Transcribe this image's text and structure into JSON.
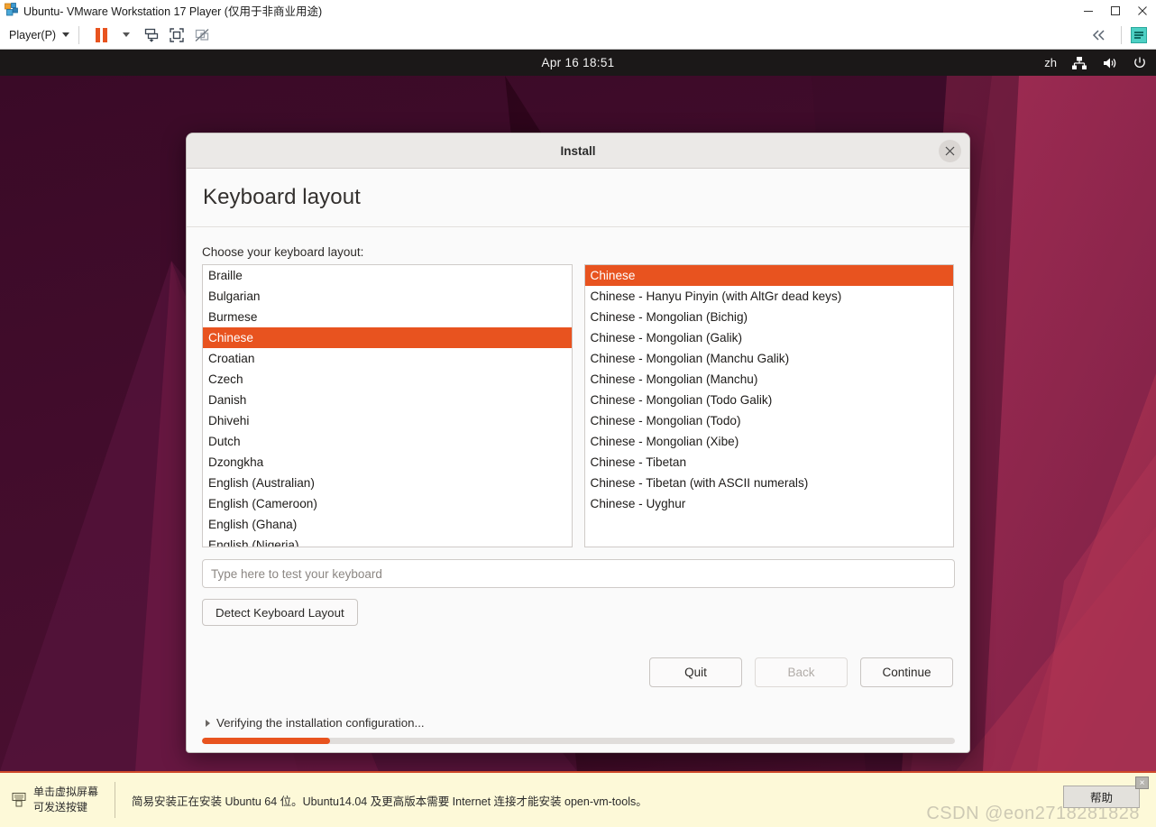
{
  "vmware": {
    "window_title": "Ubuntu- VMware Workstation 17 Player (仅用于非商业用途)",
    "app_icon": "vmware-logo-icon",
    "window_buttons": {
      "minimize": "minimize-icon",
      "maximize": "maximize-icon",
      "close": "close-icon"
    },
    "toolbar": {
      "player_menu": "Player(P)",
      "pause_button": "pause-icon",
      "pause_dropdown": "chevron-down-icon",
      "send_ctrl_alt_del": "send-key-icon",
      "fullscreen": "fullscreen-icon",
      "unity_mode": "unity-mode-icon",
      "collapse": "collapse-icon",
      "notes": "notes-icon"
    },
    "status_bar": {
      "hint_line1": "单击虚拟屏幕",
      "hint_line2": "可发送按键",
      "keyboard_icon": "keyboard-icon",
      "message": "简易安装正在安装 Ubuntu 64 位。Ubuntu14.04 及更高版本需要 Internet 连接才能安装 open-vm-tools。",
      "help_button": "帮助",
      "close_button": "×",
      "watermark": "CSDN @eon2718281828"
    }
  },
  "guest": {
    "panel": {
      "clock": "Apr 16  18:51",
      "keyboard_indicator": "zh",
      "network_icon": "network-wired-icon",
      "volume_icon": "volume-icon",
      "power_icon": "power-icon"
    },
    "wallpaper_colors": {
      "base": "#3b0a28",
      "dark": "#2d0520",
      "mid": "#772249",
      "light": "#9e2b52",
      "accent": "#b03050"
    }
  },
  "dialog": {
    "title": "Install",
    "close_label": "×",
    "page_title": "Keyboard layout",
    "choose_label": "Choose your keyboard layout:",
    "language_list": [
      {
        "label": "Braille",
        "selected": false
      },
      {
        "label": "Bulgarian",
        "selected": false
      },
      {
        "label": "Burmese",
        "selected": false
      },
      {
        "label": "Chinese",
        "selected": true
      },
      {
        "label": "Croatian",
        "selected": false
      },
      {
        "label": "Czech",
        "selected": false
      },
      {
        "label": "Danish",
        "selected": false
      },
      {
        "label": "Dhivehi",
        "selected": false
      },
      {
        "label": "Dutch",
        "selected": false
      },
      {
        "label": "Dzongkha",
        "selected": false
      },
      {
        "label": "English (Australian)",
        "selected": false
      },
      {
        "label": "English (Cameroon)",
        "selected": false
      },
      {
        "label": "English (Ghana)",
        "selected": false
      },
      {
        "label": "English (Nigeria)",
        "selected": false
      }
    ],
    "variant_list": [
      {
        "label": "Chinese",
        "selected": true
      },
      {
        "label": "Chinese - Hanyu Pinyin (with AltGr dead keys)",
        "selected": false
      },
      {
        "label": "Chinese - Mongolian (Bichig)",
        "selected": false
      },
      {
        "label": "Chinese - Mongolian (Galik)",
        "selected": false
      },
      {
        "label": "Chinese - Mongolian (Manchu Galik)",
        "selected": false
      },
      {
        "label": "Chinese - Mongolian (Manchu)",
        "selected": false
      },
      {
        "label": "Chinese - Mongolian (Todo Galik)",
        "selected": false
      },
      {
        "label": "Chinese - Mongolian (Todo)",
        "selected": false
      },
      {
        "label": "Chinese - Mongolian (Xibe)",
        "selected": false
      },
      {
        "label": "Chinese - Tibetan",
        "selected": false
      },
      {
        "label": "Chinese - Tibetan (with ASCII numerals)",
        "selected": false
      },
      {
        "label": "Chinese - Uyghur",
        "selected": false
      }
    ],
    "test_input": {
      "value": "",
      "placeholder": "Type here to test your keyboard"
    },
    "detect_button": "Detect Keyboard Layout",
    "buttons": {
      "quit": "Quit",
      "back": "Back",
      "continue": "Continue"
    },
    "progress": {
      "label": "Verifying the installation configuration...",
      "percent": 17,
      "accent_color": "#e8531f"
    }
  }
}
